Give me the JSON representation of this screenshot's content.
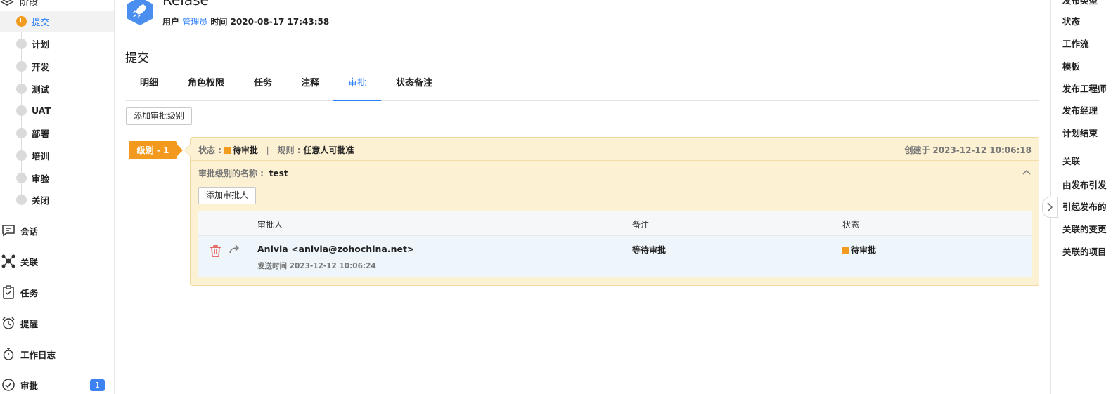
{
  "sidebar": {
    "top_item": "阶段",
    "stages": [
      {
        "label": "提交",
        "active": true
      },
      {
        "label": "计划"
      },
      {
        "label": "开发"
      },
      {
        "label": "测试"
      },
      {
        "label": "UAT"
      },
      {
        "label": "部署"
      },
      {
        "label": "培训"
      },
      {
        "label": "审验"
      },
      {
        "label": "关闭"
      }
    ],
    "nav": [
      {
        "label": "会话",
        "icon": "chat-icon"
      },
      {
        "label": "关联",
        "icon": "relation-icon"
      },
      {
        "label": "任务",
        "icon": "clipboard-icon"
      },
      {
        "label": "提醒",
        "icon": "alarm-clock-icon"
      },
      {
        "label": "工作日志",
        "icon": "stopwatch-icon"
      },
      {
        "label": "审批",
        "icon": "check-circle-icon",
        "badge": "1"
      }
    ]
  },
  "header": {
    "title": "Relase",
    "user_label": "用户",
    "user_name": "管理员",
    "time_label": "时间",
    "time_value": "2020-08-17 17:43:58"
  },
  "section_title": "提交",
  "tabs": [
    {
      "label": "明细"
    },
    {
      "label": "角色权限"
    },
    {
      "label": "任务"
    },
    {
      "label": "注释"
    },
    {
      "label": "审批",
      "active": true
    },
    {
      "label": "状态备注"
    }
  ],
  "add_level_button": "添加审批级别",
  "approval_level": {
    "badge": "级别 - 1",
    "status_label": "状态 :",
    "status_value": "待审批",
    "rule_label": "规则 :",
    "rule_value": "任意人可批准",
    "created_label": "创建于",
    "created_value": "2023-12-12 10:06:18",
    "name_label": "审批级别的名称 :",
    "name_value": "test",
    "add_approver_button": "添加审批人",
    "table": {
      "headers": [
        "审批人",
        "备注",
        "状态"
      ],
      "rows": [
        {
          "approver": "Anivia <anivia@zohochina.net>",
          "sent": "发送时间 2023-12-12 10:06:24",
          "note": "等待审批",
          "status": "待审批"
        }
      ]
    }
  },
  "right_sidebar": {
    "items": [
      "发布类型",
      "状态",
      "工作流",
      "模板",
      "发布工程师",
      "发布经理",
      "计划结束",
      "关联",
      "由发布引发",
      "引起发布的",
      "关联的变更",
      "关联的项目"
    ]
  },
  "colors": {
    "accent": "#2d7ff9",
    "pending": "#f29c1f",
    "panel_bg": "#fdf1d3"
  }
}
